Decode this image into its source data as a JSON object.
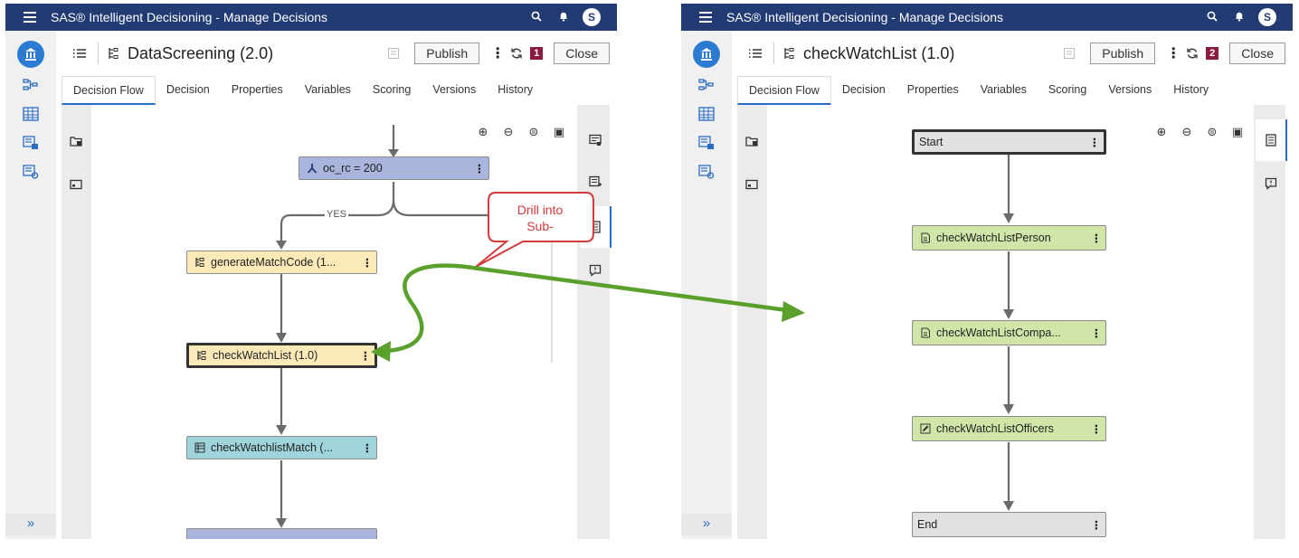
{
  "app_title": "SAS® Intelligent Decisioning - Manage Decisions",
  "user_initial": "S",
  "colors": {
    "titlebar": "#223c73",
    "accent": "#2b6cc4",
    "badge": "#8b1a3e",
    "arrow": "#5aa02c",
    "callout": "#d53a3a"
  },
  "left_nav": {
    "home_icon": "decision-home-icon",
    "items": [
      "flow-icon",
      "table-icon",
      "rule-set-icon",
      "model-icon"
    ],
    "expand_label": "»"
  },
  "win1": {
    "decision_name": "DataScreening (2.0)",
    "publish_label": "Publish",
    "close_label": "Close",
    "badge": "1",
    "tabs": [
      "Decision Flow",
      "Decision",
      "Properties",
      "Variables",
      "Scoring",
      "Versions",
      "History"
    ],
    "nodes": {
      "cond": "oc_rc = 200",
      "yes_label": "YES",
      "gen": "generateMatchCode (1...",
      "check": "checkWatchList (1.0)",
      "match": "checkWatchlistMatch (..."
    }
  },
  "win2": {
    "decision_name": "checkWatchList (1.0)",
    "publish_label": "Publish",
    "close_label": "Close",
    "badge": "2",
    "tabs": [
      "Decision Flow",
      "Decision",
      "Properties",
      "Variables",
      "Scoring",
      "Versions",
      "History"
    ],
    "nodes": {
      "start": "Start",
      "person": "checkWatchListPerson",
      "company": "checkWatchListCompa...",
      "officers": "checkWatchListOfficers",
      "end": "End"
    }
  },
  "callout": {
    "line1": "Drill into",
    "line2": "Sub-"
  }
}
